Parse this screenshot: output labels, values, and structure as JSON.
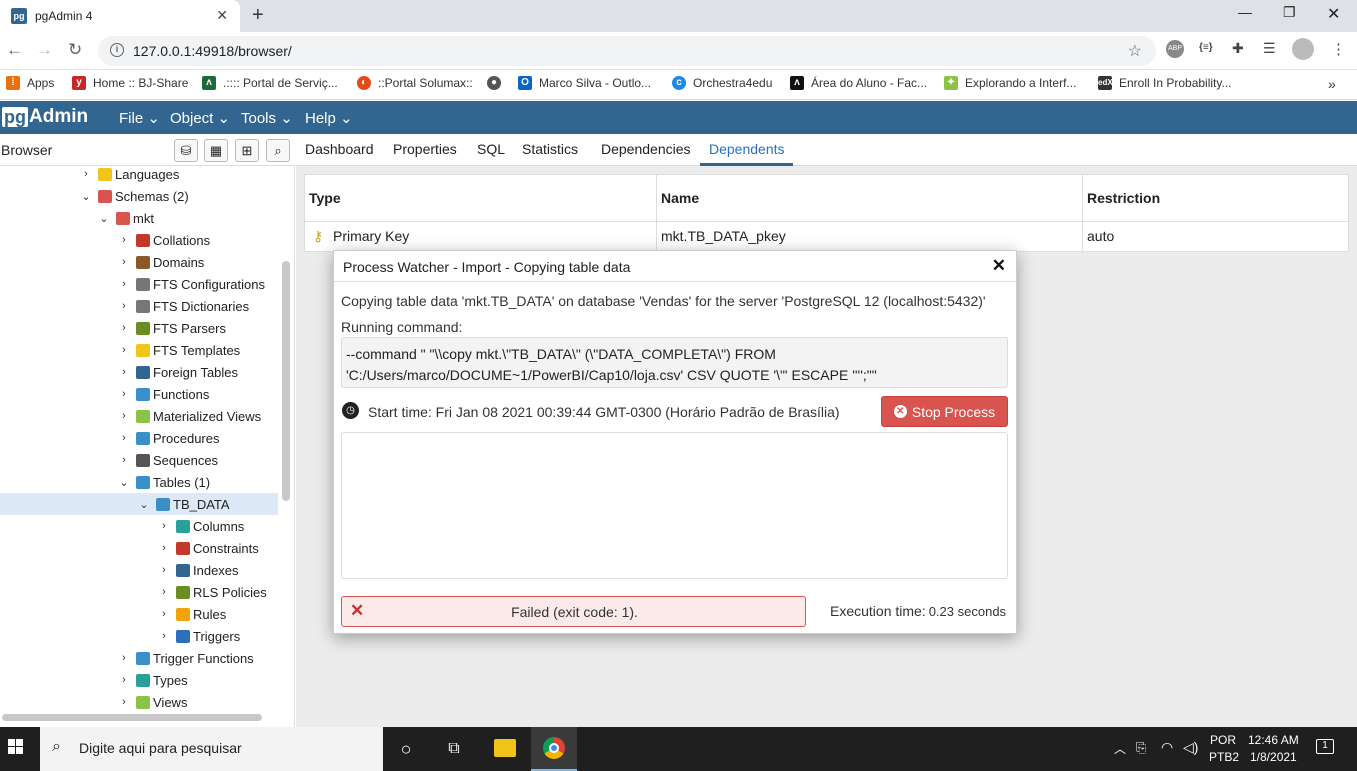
{
  "browser": {
    "tab_title": "pgAdmin 4",
    "tab_favicon": "pg",
    "url": "127.0.0.1:49918/browser/",
    "bookmarks": [
      {
        "label": "Apps",
        "icon": "apps-grid-icon"
      },
      {
        "label": "Home :: BJ-Share",
        "icon": "bj-share-icon"
      },
      {
        "label": ".:::: Portal de Serviç...",
        "icon": "portal-icon"
      },
      {
        "label": "::Portal Solumax::",
        "icon": "solumax-icon"
      },
      {
        "label": "",
        "icon": "globe-icon"
      },
      {
        "label": "Marco Silva - Outlo...",
        "icon": "outlook-icon"
      },
      {
        "label": "Orchestra4edu",
        "icon": "orchestra-icon"
      },
      {
        "label": "Área do Aluno - Fac...",
        "icon": "area-aluno-icon"
      },
      {
        "label": "Explorando a Interf...",
        "icon": "explorando-icon"
      },
      {
        "label": "Enroll In Probability...",
        "icon": "edx-icon"
      }
    ],
    "ext_abp": "ABP",
    "ext_json": "{≡}"
  },
  "pgadmin": {
    "logo_pg": "pg",
    "logo_text": "Admin",
    "menus": [
      "File",
      "Object",
      "Tools",
      "Help"
    ],
    "browser_title": "Browser",
    "tree": [
      {
        "label": "Languages",
        "chev": "›",
        "icon_color": "#f0c419"
      },
      {
        "label": "Schemas (2)",
        "chev": "⌄",
        "icon_color": "#d9534f"
      },
      {
        "label": "mkt",
        "chev": "⌄",
        "icon_color": "#d9534f"
      },
      {
        "label": "Collations",
        "chev": "›",
        "icon_color": "#c0392b"
      },
      {
        "label": "Domains",
        "chev": "›",
        "icon_color": "#8b5a2b"
      },
      {
        "label": "FTS Configurations",
        "chev": "›",
        "icon_color": "#777777"
      },
      {
        "label": "FTS Dictionaries",
        "chev": "›",
        "icon_color": "#777777"
      },
      {
        "label": "FTS Parsers",
        "chev": "›",
        "icon_color": "#6b8e23"
      },
      {
        "label": "FTS Templates",
        "chev": "›",
        "icon_color": "#f0c419"
      },
      {
        "label": "Foreign Tables",
        "chev": "›",
        "icon_color": "#326690"
      },
      {
        "label": "Functions",
        "chev": "›",
        "icon_color": "#3a8fc7"
      },
      {
        "label": "Materialized Views",
        "chev": "›",
        "icon_color": "#8bc34a"
      },
      {
        "label": "Procedures",
        "chev": "›",
        "icon_color": "#3a8fc7"
      },
      {
        "label": "Sequences",
        "chev": "›",
        "icon_color": "#555555"
      },
      {
        "label": "Tables (1)",
        "chev": "⌄",
        "icon_color": "#3a8fc7"
      },
      {
        "label": "TB_DATA",
        "chev": "⌄",
        "icon_color": "#3a8fc7"
      },
      {
        "label": "Columns",
        "chev": "›",
        "icon_color": "#2aa198"
      },
      {
        "label": "Constraints",
        "chev": "›",
        "icon_color": "#c0392b"
      },
      {
        "label": "Indexes",
        "chev": "›",
        "icon_color": "#326690"
      },
      {
        "label": "RLS Policies",
        "chev": "›",
        "icon_color": "#6b8e23"
      },
      {
        "label": "Rules",
        "chev": "›",
        "icon_color": "#f0a30a"
      },
      {
        "label": "Triggers",
        "chev": "›",
        "icon_color": "#2c6fbb"
      },
      {
        "label": "Trigger Functions",
        "chev": "›",
        "icon_color": "#3a8fc7"
      },
      {
        "label": "Types",
        "chev": "›",
        "icon_color": "#2aa198"
      },
      {
        "label": "Views",
        "chev": "›",
        "icon_color": "#8bc34a"
      }
    ],
    "selected_tree_item": "TB_DATA",
    "panel_tabs": [
      "Dashboard",
      "Properties",
      "SQL",
      "Statistics",
      "Dependencies",
      "Dependents"
    ],
    "active_tab": "Dependents",
    "dependents_table": {
      "headers": [
        "Type",
        "Name",
        "Restriction"
      ],
      "rows": [
        {
          "type": "Primary Key",
          "name": "mkt.TB_DATA_pkey",
          "restriction": "auto"
        }
      ]
    }
  },
  "dialog": {
    "title": "Process Watcher - Import - Copying table data",
    "description": "Copying table data 'mkt.TB_DATA' on database 'Vendas' for the server 'PostgreSQL 12 (localhost:5432)'",
    "running_label": "Running command:",
    "command_line1": "--command \" \"\\\\copy mkt.\\\"TB_DATA\\\" (\\\"DATA_COMPLETA\\\") FROM",
    "command_line2": "'C:/Users/marco/DOCUME~1/PowerBI/Cap10/loja.csv' CSV QUOTE '\\\"' ESCAPE '''';\"\"",
    "start_time": "Start time: Fri Jan 08 2021 00:39:44 GMT-0300 (Horário Padrão de Brasília)",
    "stop_button": "Stop Process",
    "status": "Failed (exit code: 1).",
    "execution_label": "Execution time:",
    "execution_value": "0.23 seconds",
    "status_color": "#d9534f"
  },
  "taskbar": {
    "search_placeholder": "Digite aqui para pesquisar",
    "lang_top": "POR",
    "lang_bottom": "PTB2",
    "time": "12:46 AM",
    "date": "1/8/2021",
    "notifications": "1"
  }
}
